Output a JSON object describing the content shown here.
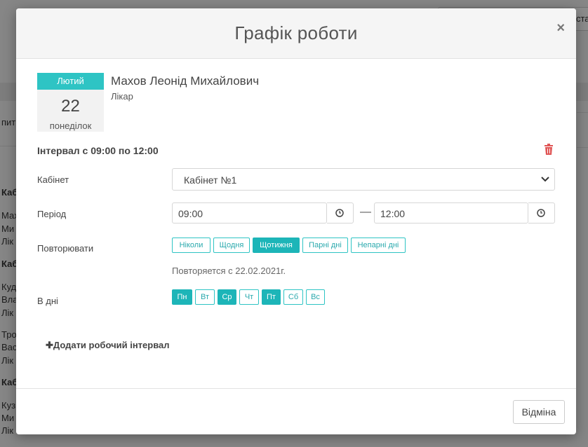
{
  "background": {
    "top_button_fragment": "ста",
    "rows": [
      {
        "text": "пить"
      },
      {
        "text": "Каб",
        "bold": true
      },
      {
        "text": "Мах"
      },
      {
        "text": "Ми"
      },
      {
        "text": "Лік"
      },
      {
        "text": "Каб",
        "bold": true
      },
      {
        "text": "Куд"
      },
      {
        "text": "Вла"
      },
      {
        "text": "Лік"
      },
      {
        "text": "Тро"
      },
      {
        "text": "Вас"
      },
      {
        "text": "Лік"
      },
      {
        "text": "Каб",
        "bold": true
      },
      {
        "text": "Куз"
      },
      {
        "text": "Ми"
      },
      {
        "text": "Лік"
      }
    ]
  },
  "modal": {
    "title": "Графік роботи",
    "close_symbol": "×",
    "date": {
      "month": "Лютий",
      "day": "22",
      "weekday": "понеділок"
    },
    "person": {
      "name": "Махов Леонід Михайлович",
      "role": "Лікар"
    },
    "interval_title": "Інтервал с 09:00 по 12:00",
    "cabinet": {
      "label": "Кабінет",
      "value": "Кабінет №1"
    },
    "period": {
      "label": "Період",
      "from": "09:00",
      "to": "12:00",
      "separator": "—"
    },
    "repeat": {
      "label": "Повторювати",
      "options": [
        {
          "label": "Ніколи",
          "active": false
        },
        {
          "label": "Щодня",
          "active": false
        },
        {
          "label": "Щотижня",
          "active": true
        },
        {
          "label": "Парні дні",
          "active": false
        },
        {
          "label": "Непарні дні",
          "active": false
        }
      ],
      "note": "Повторяется с 22.02.2021г."
    },
    "days": {
      "label": "В дні",
      "items": [
        {
          "label": "Пн",
          "active": true
        },
        {
          "label": "Вт",
          "active": false
        },
        {
          "label": "Ср",
          "active": true
        },
        {
          "label": "Чт",
          "active": false
        },
        {
          "label": "Пт",
          "active": true
        },
        {
          "label": "Сб",
          "active": false
        },
        {
          "label": "Вс",
          "active": false
        }
      ]
    },
    "add_interval": "✚Додати робочий інтервал",
    "cancel": "Відміна"
  },
  "colors": {
    "accent": "#2ec4c4",
    "accent_dark": "#1db5b8",
    "danger": "#e05555"
  }
}
